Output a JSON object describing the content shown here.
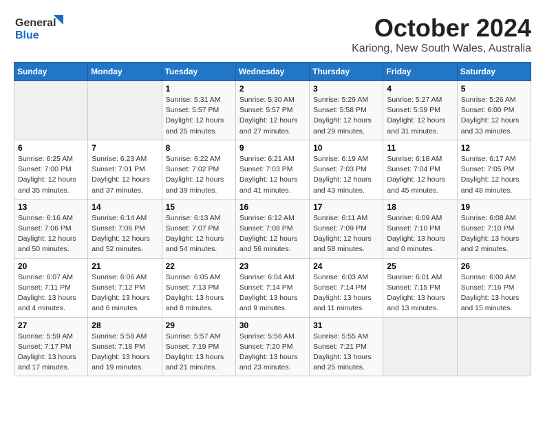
{
  "logo": {
    "line1": "General",
    "line2": "Blue"
  },
  "title": "October 2024",
  "subtitle": "Kariong, New South Wales, Australia",
  "days_of_week": [
    "Sunday",
    "Monday",
    "Tuesday",
    "Wednesday",
    "Thursday",
    "Friday",
    "Saturday"
  ],
  "weeks": [
    [
      {
        "day": "",
        "info": ""
      },
      {
        "day": "",
        "info": ""
      },
      {
        "day": "1",
        "info": "Sunrise: 5:31 AM\nSunset: 5:57 PM\nDaylight: 12 hours\nand 25 minutes."
      },
      {
        "day": "2",
        "info": "Sunrise: 5:30 AM\nSunset: 5:57 PM\nDaylight: 12 hours\nand 27 minutes."
      },
      {
        "day": "3",
        "info": "Sunrise: 5:29 AM\nSunset: 5:58 PM\nDaylight: 12 hours\nand 29 minutes."
      },
      {
        "day": "4",
        "info": "Sunrise: 5:27 AM\nSunset: 5:59 PM\nDaylight: 12 hours\nand 31 minutes."
      },
      {
        "day": "5",
        "info": "Sunrise: 5:26 AM\nSunset: 6:00 PM\nDaylight: 12 hours\nand 33 minutes."
      }
    ],
    [
      {
        "day": "6",
        "info": "Sunrise: 6:25 AM\nSunset: 7:00 PM\nDaylight: 12 hours\nand 35 minutes."
      },
      {
        "day": "7",
        "info": "Sunrise: 6:23 AM\nSunset: 7:01 PM\nDaylight: 12 hours\nand 37 minutes."
      },
      {
        "day": "8",
        "info": "Sunrise: 6:22 AM\nSunset: 7:02 PM\nDaylight: 12 hours\nand 39 minutes."
      },
      {
        "day": "9",
        "info": "Sunrise: 6:21 AM\nSunset: 7:03 PM\nDaylight: 12 hours\nand 41 minutes."
      },
      {
        "day": "10",
        "info": "Sunrise: 6:19 AM\nSunset: 7:03 PM\nDaylight: 12 hours\nand 43 minutes."
      },
      {
        "day": "11",
        "info": "Sunrise: 6:18 AM\nSunset: 7:04 PM\nDaylight: 12 hours\nand 45 minutes."
      },
      {
        "day": "12",
        "info": "Sunrise: 6:17 AM\nSunset: 7:05 PM\nDaylight: 12 hours\nand 48 minutes."
      }
    ],
    [
      {
        "day": "13",
        "info": "Sunrise: 6:16 AM\nSunset: 7:06 PM\nDaylight: 12 hours\nand 50 minutes."
      },
      {
        "day": "14",
        "info": "Sunrise: 6:14 AM\nSunset: 7:06 PM\nDaylight: 12 hours\nand 52 minutes."
      },
      {
        "day": "15",
        "info": "Sunrise: 6:13 AM\nSunset: 7:07 PM\nDaylight: 12 hours\nand 54 minutes."
      },
      {
        "day": "16",
        "info": "Sunrise: 6:12 AM\nSunset: 7:08 PM\nDaylight: 12 hours\nand 56 minutes."
      },
      {
        "day": "17",
        "info": "Sunrise: 6:11 AM\nSunset: 7:09 PM\nDaylight: 12 hours\nand 58 minutes."
      },
      {
        "day": "18",
        "info": "Sunrise: 6:09 AM\nSunset: 7:10 PM\nDaylight: 13 hours\nand 0 minutes."
      },
      {
        "day": "19",
        "info": "Sunrise: 6:08 AM\nSunset: 7:10 PM\nDaylight: 13 hours\nand 2 minutes."
      }
    ],
    [
      {
        "day": "20",
        "info": "Sunrise: 6:07 AM\nSunset: 7:11 PM\nDaylight: 13 hours\nand 4 minutes."
      },
      {
        "day": "21",
        "info": "Sunrise: 6:06 AM\nSunset: 7:12 PM\nDaylight: 13 hours\nand 6 minutes."
      },
      {
        "day": "22",
        "info": "Sunrise: 6:05 AM\nSunset: 7:13 PM\nDaylight: 13 hours\nand 8 minutes."
      },
      {
        "day": "23",
        "info": "Sunrise: 6:04 AM\nSunset: 7:14 PM\nDaylight: 13 hours\nand 9 minutes."
      },
      {
        "day": "24",
        "info": "Sunrise: 6:03 AM\nSunset: 7:14 PM\nDaylight: 13 hours\nand 11 minutes."
      },
      {
        "day": "25",
        "info": "Sunrise: 6:01 AM\nSunset: 7:15 PM\nDaylight: 13 hours\nand 13 minutes."
      },
      {
        "day": "26",
        "info": "Sunrise: 6:00 AM\nSunset: 7:16 PM\nDaylight: 13 hours\nand 15 minutes."
      }
    ],
    [
      {
        "day": "27",
        "info": "Sunrise: 5:59 AM\nSunset: 7:17 PM\nDaylight: 13 hours\nand 17 minutes."
      },
      {
        "day": "28",
        "info": "Sunrise: 5:58 AM\nSunset: 7:18 PM\nDaylight: 13 hours\nand 19 minutes."
      },
      {
        "day": "29",
        "info": "Sunrise: 5:57 AM\nSunset: 7:19 PM\nDaylight: 13 hours\nand 21 minutes."
      },
      {
        "day": "30",
        "info": "Sunrise: 5:56 AM\nSunset: 7:20 PM\nDaylight: 13 hours\nand 23 minutes."
      },
      {
        "day": "31",
        "info": "Sunrise: 5:55 AM\nSunset: 7:21 PM\nDaylight: 13 hours\nand 25 minutes."
      },
      {
        "day": "",
        "info": ""
      },
      {
        "day": "",
        "info": ""
      }
    ]
  ]
}
